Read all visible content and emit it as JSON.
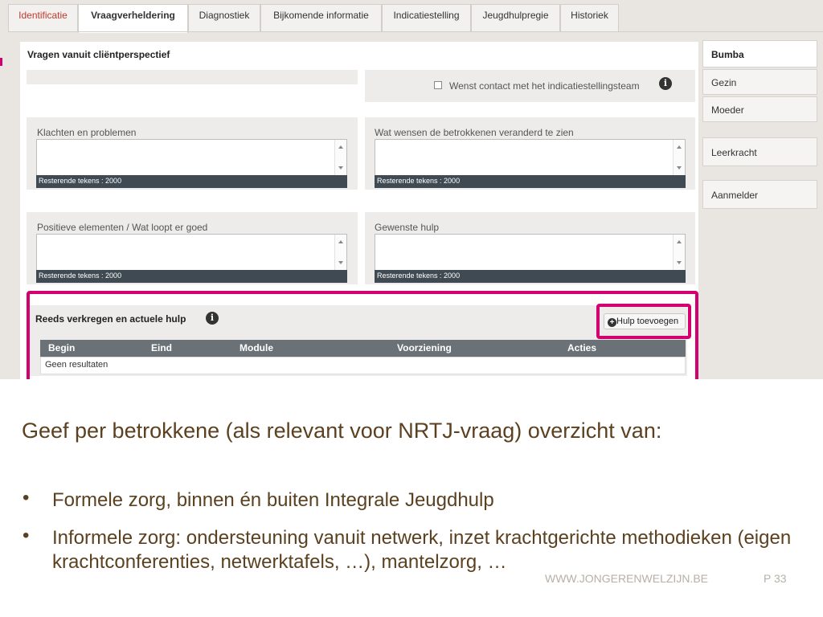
{
  "tabs": [
    {
      "label": "Identificatie"
    },
    {
      "label": "Vraagverheldering"
    },
    {
      "label": "Diagnostiek"
    },
    {
      "label": "Bijkomende informatie"
    },
    {
      "label": "Indicatiestelling"
    },
    {
      "label": "Jeugdhulpregie"
    },
    {
      "label": "Historiek"
    }
  ],
  "panel": {
    "title": "Vragen vanuit cliëntperspectief",
    "contact_checkbox": {
      "label": "Wenst contact met het indicatiestellingsteam",
      "checked": false
    },
    "fields": [
      {
        "label": "Klachten en problemen",
        "value": "",
        "counter": "Resterende tekens : 2000"
      },
      {
        "label": "Wat wensen de betrokkenen veranderd te zien",
        "value": "",
        "counter": "Resterende tekens : 2000"
      },
      {
        "label": "Positieve elementen / Wat loopt er goed",
        "value": "",
        "counter": "Resterende tekens : 2000"
      },
      {
        "label": "Gewenste hulp",
        "value": "",
        "counter": "Resterende tekens : 2000"
      }
    ]
  },
  "help_section": {
    "title": "Reeds verkregen en actuele hulp",
    "add_button": "Hulp toevoegen",
    "columns": [
      "Begin",
      "Eind",
      "Module",
      "Voorziening",
      "Acties"
    ],
    "empty_text": "Geen resultaten"
  },
  "side_tabs": [
    {
      "label": "Bumba"
    },
    {
      "label": "Gezin"
    },
    {
      "label": "Moeder"
    },
    {
      "label": "Leerkracht"
    },
    {
      "label": "Aanmelder"
    }
  ],
  "slide": {
    "paragraph": "Geef per betrokkene (als relevant voor NRTJ-vraag) overzicht van:",
    "bullets": [
      "Formele zorg, binnen én buiten Integrale Jeugdhulp",
      "Informele zorg: ondersteuning vanuit netwerk, inzet krachtgerichte methodieken (eigen krachtconferenties, netwerktafels, …), mantelzorg, …"
    ],
    "bullet_symbol": "•",
    "footer_site": "WWW.JONGERENWELZIJN.BE",
    "footer_page": "P 33"
  },
  "colors": {
    "highlight": "#d4006f",
    "text_brown": "#5c4120"
  },
  "icons": [
    "info-icon",
    "plus-circle-icon",
    "scroll-up-icon",
    "scroll-down-icon"
  ]
}
